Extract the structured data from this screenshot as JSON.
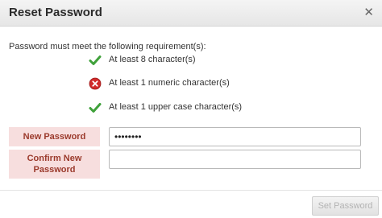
{
  "dialog": {
    "title": "Reset Password",
    "close_icon": "close-icon"
  },
  "requirements": {
    "intro": "Password must meet the following requirement(s):",
    "items": [
      {
        "text": "At least 8 character(s)",
        "status": "met",
        "icon": "check-icon"
      },
      {
        "text": "At least 1 numeric character(s)",
        "status": "unmet",
        "icon": "error-icon"
      },
      {
        "text": "At least 1 upper case character(s)",
        "status": "met",
        "icon": "check-icon"
      }
    ]
  },
  "form": {
    "new_password_label": "New Password",
    "new_password_value": "••••••••",
    "confirm_password_label": "Confirm New Password",
    "confirm_password_value": ""
  },
  "footer": {
    "submit_label": "Set Password",
    "submit_enabled": false
  },
  "colors": {
    "label_bg": "#f7dede",
    "label_text": "#9b3a2c",
    "check_green": "#3fa13a",
    "error_red": "#d12b2b"
  }
}
